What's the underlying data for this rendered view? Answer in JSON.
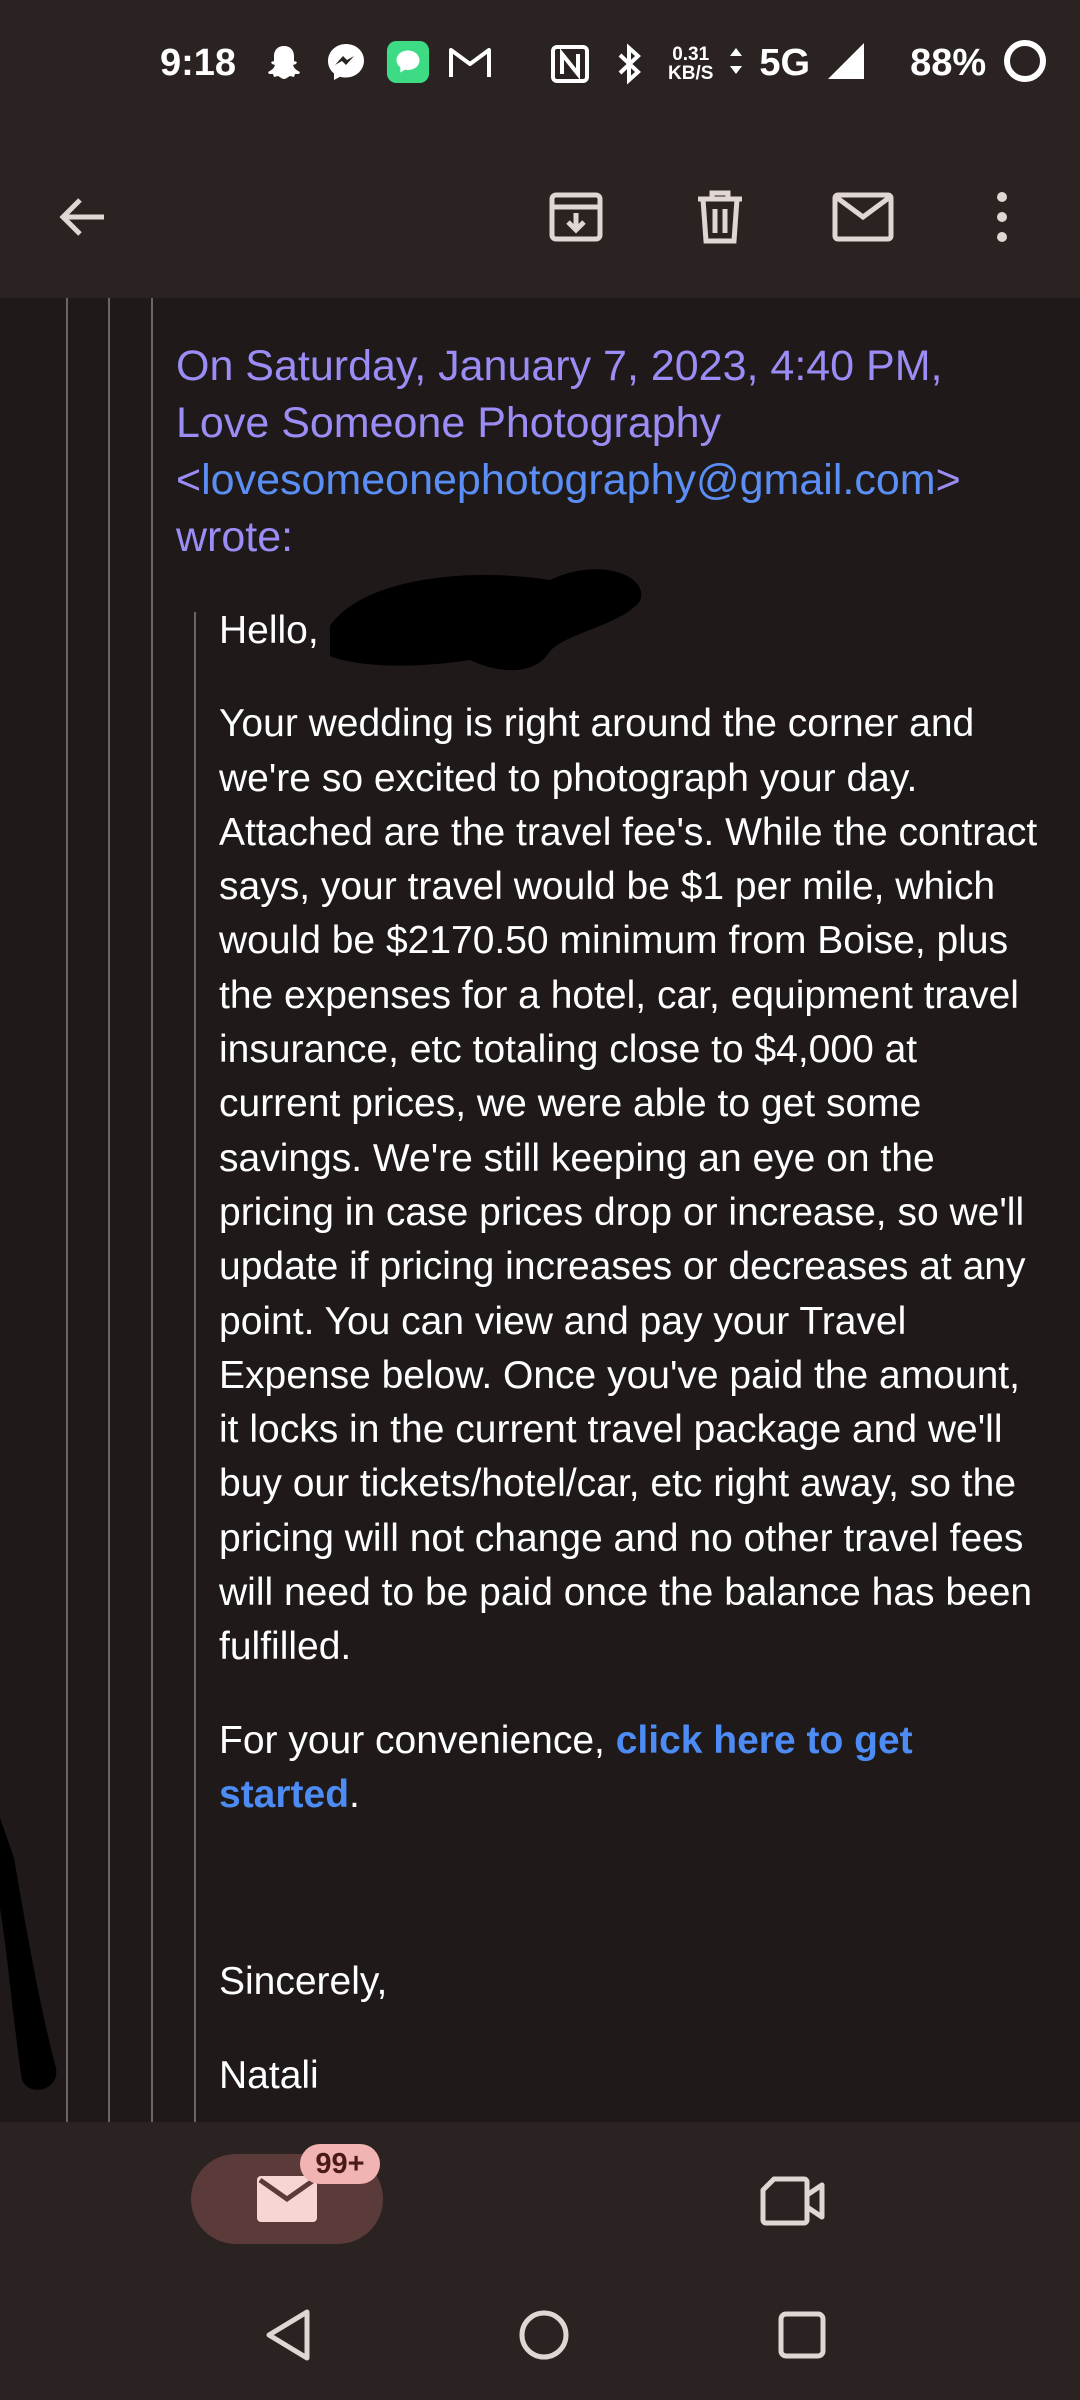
{
  "status_bar": {
    "time": "9:18",
    "speed_value": "0.31",
    "speed_unit": "KB/S",
    "network": "5G",
    "battery": "88%",
    "icons": [
      "snapchat-icon",
      "messenger-icon",
      "messages-icon",
      "gmail-icon",
      "nfc-icon",
      "bluetooth-icon",
      "data-arrows-icon",
      "signal-icon",
      "battery-ring-icon"
    ]
  },
  "toolbar": {
    "icons": [
      "back-arrow-icon",
      "archive-icon",
      "delete-icon",
      "mark-unread-icon",
      "more-vert-icon"
    ]
  },
  "email": {
    "attribution_prefix": "On Saturday, January 7, 2023, 4:40 PM, Love Someone Photography <",
    "attribution_email": "lovesomeonephotography@gmail.com",
    "attribution_suffix": "> wrote:",
    "greeting": "Hello,",
    "paragraph": "Your wedding is right around the corner and we're so excited to photograph your day. Attached are the travel fee's. While the contract says, your travel would be $1 per mile, which would be $2170.50 minimum from Boise, plus the expenses for a hotel, car, equipment travel insurance, etc totaling close to $4,000 at current prices, we were able to get some savings. We're still keeping an eye on the pricing in case prices drop or increase, so we'll update if pricing increases or decreases at any point. You can view and pay your Travel Expense below. Once you've paid the amount, it locks in the current travel package and we'll buy our tickets/hotel/car, etc right away, so the pricing will not change and no other travel fees will need to be paid once the balance has been fulfilled.",
    "convenience_prefix": "For your convenience, ",
    "convenience_link": "click here to get started",
    "convenience_suffix": ".",
    "closing": "Sincerely,",
    "signature_partial": "Natali"
  },
  "bottom_nav": {
    "mail_badge": "99+",
    "icons": [
      "mail-icon",
      "meet-video-icon"
    ]
  },
  "system_nav": {
    "icons": [
      "nav-back-icon",
      "nav-home-icon",
      "nav-recents-icon"
    ]
  },
  "colors": {
    "bar_bg": "#2b2322",
    "content_bg": "#1f1a19",
    "attribution_purple": "#9c8cf5",
    "link_blue": "#4d8cf5",
    "badge_pink": "#f1b4b2"
  }
}
